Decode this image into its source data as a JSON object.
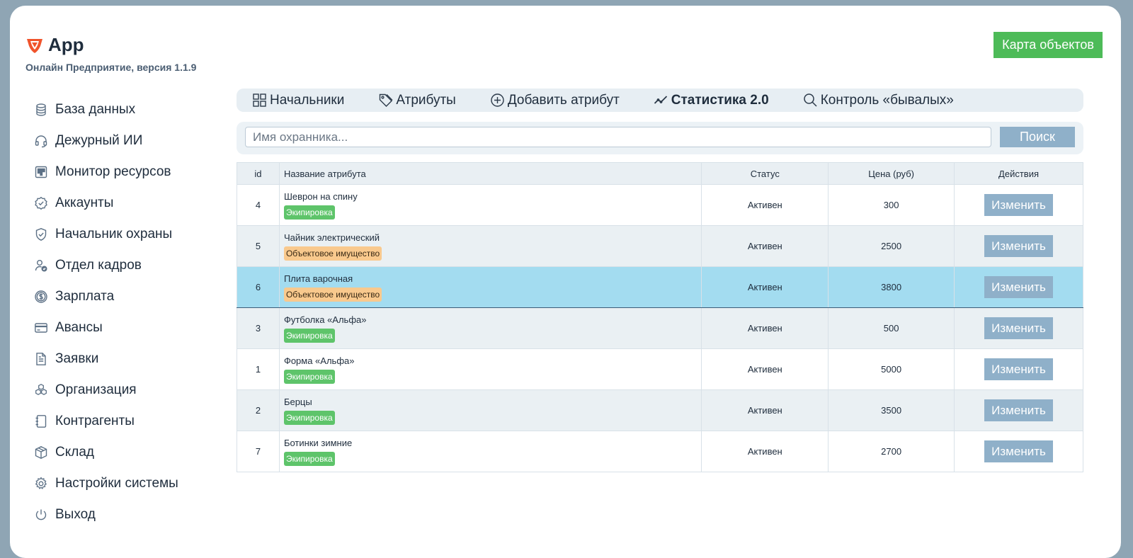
{
  "app": {
    "title": "App",
    "subtitle": "Онлайн Предприятие, версия 1.1.9",
    "logo_icon": "shield-logo-icon",
    "accent": "#f0542c"
  },
  "header": {
    "map_button": "Карта объектов",
    "map_button_color": "#4dbb58"
  },
  "sidebar": {
    "items": [
      {
        "label": "База данных",
        "icon": "database-icon"
      },
      {
        "label": "Дежурный ИИ",
        "icon": "headset-icon"
      },
      {
        "label": "Монитор ресурсов",
        "icon": "monitor-icon"
      },
      {
        "label": "Аккаунты",
        "icon": "badge-check-icon"
      },
      {
        "label": "Начальник охраны",
        "icon": "shield-check-icon"
      },
      {
        "label": "Отдел кадров",
        "icon": "user-check-icon"
      },
      {
        "label": "Зарплата",
        "icon": "dollar-icon"
      },
      {
        "label": "Авансы",
        "icon": "credit-card-icon"
      },
      {
        "label": "Заявки",
        "icon": "document-icon"
      },
      {
        "label": "Организация",
        "icon": "cubes-icon"
      },
      {
        "label": "Контрагенты",
        "icon": "notebook-icon"
      },
      {
        "label": "Склад",
        "icon": "box-icon"
      },
      {
        "label": "Настройки системы",
        "icon": "gear-icon"
      },
      {
        "label": "Выход",
        "icon": "power-icon"
      }
    ]
  },
  "tabs": [
    {
      "label": "Начальники",
      "icon": "grid-icon"
    },
    {
      "label": "Атрибуты",
      "icon": "tag-icon"
    },
    {
      "label": "Добавить атрибут",
      "icon": "plus-circle-icon"
    },
    {
      "label": "Статистика 2.0",
      "icon": "trend-icon",
      "active": true
    },
    {
      "label": "Контроль «бывалых»",
      "icon": "search-icon"
    }
  ],
  "search": {
    "placeholder": "Имя охранника...",
    "value": "",
    "button": "Поиск"
  },
  "table": {
    "headers": {
      "id": "id",
      "name": "Название атрибута",
      "status": "Статус",
      "price": "Цена (руб)",
      "actions": "Действия"
    },
    "rows": [
      {
        "id": "4",
        "name": "Шеврон на спину",
        "category": "Экипировка",
        "status": "Активен",
        "price": "300",
        "action": "Изменить"
      },
      {
        "id": "5",
        "name": "Чайник электрический",
        "category": "Объектовое имущество",
        "status": "Активен",
        "price": "2500",
        "action": "Изменить"
      },
      {
        "id": "6",
        "name": "Плита варочная",
        "category": "Объектовое имущество",
        "status": "Активен",
        "price": "3800",
        "action": "Изменить",
        "selected": true
      },
      {
        "id": "3",
        "name": "Футболка «Альфа»",
        "category": "Экипировка",
        "status": "Активен",
        "price": "500",
        "action": "Изменить"
      },
      {
        "id": "1",
        "name": "Форма «Альфа»",
        "category": "Экипировка",
        "status": "Активен",
        "price": "5000",
        "action": "Изменить"
      },
      {
        "id": "2",
        "name": "Берцы",
        "category": "Экипировка",
        "status": "Активен",
        "price": "3500",
        "action": "Изменить"
      },
      {
        "id": "7",
        "name": "Ботинки зимние",
        "category": "Экипировка",
        "status": "Активен",
        "price": "2700",
        "action": "Изменить"
      }
    ]
  }
}
